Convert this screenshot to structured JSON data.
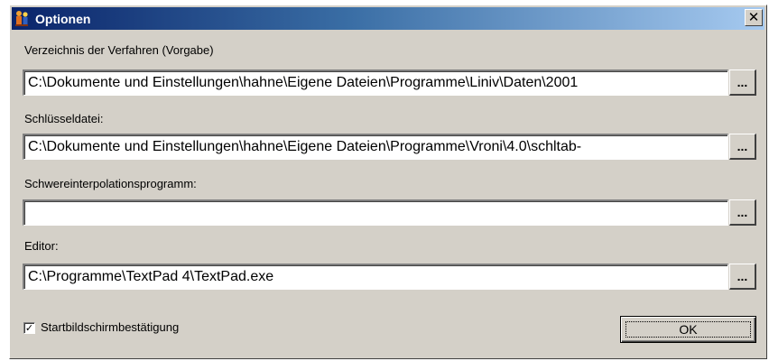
{
  "window": {
    "title": "Optionen",
    "icon": "app-people-icon",
    "close_label": "✕"
  },
  "fields": [
    {
      "label": "Verzeichnis der Verfahren (Vorgabe)",
      "value": "C:\\Dokumente und Einstellungen\\hahne\\Eigene Dateien\\Programme\\Liniv\\Daten\\2001",
      "browse_label": "..."
    },
    {
      "label": "Schlüsseldatei:",
      "value": "C:\\Dokumente und Einstellungen\\hahne\\Eigene Dateien\\Programme\\Vroni\\4.0\\schltab-",
      "browse_label": "..."
    },
    {
      "label": "Schwereinterpolationsprogramm:",
      "value": "",
      "browse_label": "..."
    },
    {
      "label": "Editor:",
      "value": "C:\\Programme\\TextPad 4\\TextPad.exe",
      "browse_label": "..."
    }
  ],
  "checkbox": {
    "label": "Startbildschirmbestätigung",
    "checked": true,
    "mark": "✓"
  },
  "ok_button": {
    "label": "OK"
  }
}
